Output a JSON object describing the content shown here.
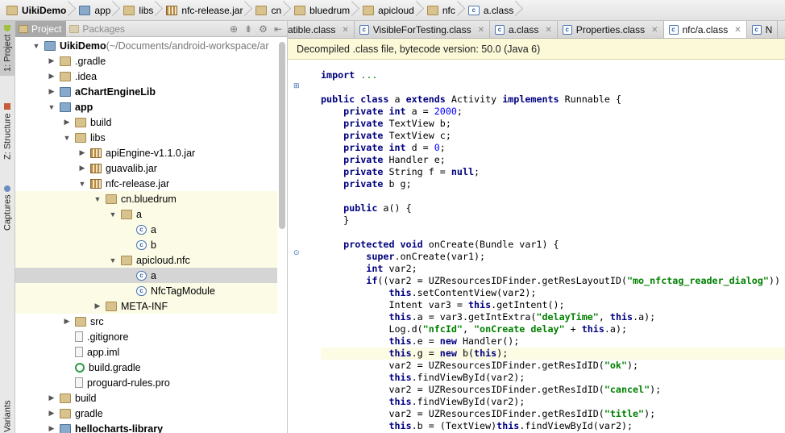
{
  "breadcrumb": [
    {
      "label": "UikiDemo",
      "bold": true,
      "icon": "folder-icon"
    },
    {
      "label": "app",
      "bold": false,
      "icon": "module-folder-icon"
    },
    {
      "label": "libs",
      "bold": false,
      "icon": "folder-icon"
    },
    {
      "label": "nfc-release.jar",
      "bold": false,
      "icon": "jar-icon"
    },
    {
      "label": "cn",
      "bold": false,
      "icon": "package-icon"
    },
    {
      "label": "bluedrum",
      "bold": false,
      "icon": "package-icon"
    },
    {
      "label": "apicloud",
      "bold": false,
      "icon": "package-icon"
    },
    {
      "label": "nfc",
      "bold": false,
      "icon": "package-icon"
    },
    {
      "label": "a.class",
      "bold": false,
      "icon": "class-file-icon"
    }
  ],
  "toolstrip": {
    "project": "1: Project",
    "structure": "Z: Structure",
    "captures": "Captures",
    "variants": "Variants"
  },
  "panel": {
    "tab_project": "Project",
    "tab_packages": "Packages"
  },
  "tree": [
    {
      "depth": 0,
      "arrow": "down",
      "icon": "module",
      "label": "UikiDemo",
      "suffix": " (~/Documents/android-workspace/ar",
      "bold": true
    },
    {
      "depth": 1,
      "arrow": "right",
      "icon": "folder",
      "label": ".gradle"
    },
    {
      "depth": 1,
      "arrow": "right",
      "icon": "folder",
      "label": ".idea"
    },
    {
      "depth": 1,
      "arrow": "right",
      "icon": "module",
      "label": "aChartEngineLib",
      "bold": true
    },
    {
      "depth": 1,
      "arrow": "down",
      "icon": "module",
      "label": "app",
      "bold": true
    },
    {
      "depth": 2,
      "arrow": "right",
      "icon": "folder",
      "label": "build"
    },
    {
      "depth": 2,
      "arrow": "down",
      "icon": "folder",
      "label": "libs"
    },
    {
      "depth": 3,
      "arrow": "right",
      "icon": "jar",
      "label": "apiEngine-v1.1.0.jar"
    },
    {
      "depth": 3,
      "arrow": "right",
      "icon": "jar",
      "label": "guavalib.jar"
    },
    {
      "depth": 3,
      "arrow": "down",
      "icon": "jar",
      "label": "nfc-release.jar"
    },
    {
      "depth": 4,
      "arrow": "down",
      "icon": "package",
      "label": "cn.bluedrum",
      "hl": true
    },
    {
      "depth": 5,
      "arrow": "down",
      "icon": "package",
      "label": "a",
      "hl": true
    },
    {
      "depth": 6,
      "arrow": "",
      "icon": "class",
      "label": "a",
      "hl": true
    },
    {
      "depth": 6,
      "arrow": "",
      "icon": "class",
      "label": "b",
      "hl": true
    },
    {
      "depth": 5,
      "arrow": "down",
      "icon": "package",
      "label": "apicloud.nfc",
      "hl": true
    },
    {
      "depth": 6,
      "arrow": "",
      "icon": "class",
      "label": "a",
      "selected": true
    },
    {
      "depth": 6,
      "arrow": "",
      "icon": "class",
      "label": "NfcTagModule",
      "hl": true
    },
    {
      "depth": 4,
      "arrow": "right",
      "icon": "folder",
      "label": "META-INF",
      "hl": true
    },
    {
      "depth": 2,
      "arrow": "right",
      "icon": "folder",
      "label": "src"
    },
    {
      "depth": 2,
      "arrow": "",
      "icon": "file",
      "label": ".gitignore"
    },
    {
      "depth": 2,
      "arrow": "",
      "icon": "file",
      "label": "app.iml"
    },
    {
      "depth": 2,
      "arrow": "",
      "icon": "gradle",
      "label": "build.gradle"
    },
    {
      "depth": 2,
      "arrow": "",
      "icon": "file",
      "label": "proguard-rules.pro"
    },
    {
      "depth": 1,
      "arrow": "right",
      "icon": "folder",
      "label": "build"
    },
    {
      "depth": 1,
      "arrow": "right",
      "icon": "folder",
      "label": "gradle"
    },
    {
      "depth": 1,
      "arrow": "right",
      "icon": "module",
      "label": "hellocharts-library",
      "bold": true
    }
  ],
  "editor_tabs": [
    {
      "label": "atible.class",
      "icon": "class-file-icon",
      "active": false
    },
    {
      "label": "VisibleForTesting.class",
      "icon": "class-file-icon",
      "active": false
    },
    {
      "label": "a.class",
      "icon": "class-file-icon",
      "active": false
    },
    {
      "label": "Properties.class",
      "icon": "class-file-icon",
      "active": false
    },
    {
      "label": "nfc/a.class",
      "icon": "class-file-icon",
      "active": true
    },
    {
      "label": "N",
      "icon": "class-file-icon",
      "active": false
    }
  ],
  "notice": "Decompiled .class file, bytecode version: 50.0 (Java 6)",
  "code": [
    [
      {
        "t": "import",
        "c": "kw"
      },
      {
        "t": " "
      },
      {
        "t": "...",
        "c": "fold"
      }
    ],
    [],
    [
      {
        "t": "public class",
        "c": "kw"
      },
      {
        "t": " a "
      },
      {
        "t": "extends",
        "c": "kw"
      },
      {
        "t": " Activity "
      },
      {
        "t": "implements",
        "c": "kw"
      },
      {
        "t": " Runnable {"
      }
    ],
    [
      {
        "t": "    "
      },
      {
        "t": "private int",
        "c": "kw"
      },
      {
        "t": " a = "
      },
      {
        "t": "2000",
        "c": "num"
      },
      {
        "t": ";"
      }
    ],
    [
      {
        "t": "    "
      },
      {
        "t": "private",
        "c": "kw"
      },
      {
        "t": " TextView b;"
      }
    ],
    [
      {
        "t": "    "
      },
      {
        "t": "private",
        "c": "kw"
      },
      {
        "t": " TextView c;"
      }
    ],
    [
      {
        "t": "    "
      },
      {
        "t": "private int",
        "c": "kw"
      },
      {
        "t": " d = "
      },
      {
        "t": "0",
        "c": "num"
      },
      {
        "t": ";"
      }
    ],
    [
      {
        "t": "    "
      },
      {
        "t": "private",
        "c": "kw"
      },
      {
        "t": " Handler e;"
      }
    ],
    [
      {
        "t": "    "
      },
      {
        "t": "private",
        "c": "kw"
      },
      {
        "t": " String f = "
      },
      {
        "t": "null",
        "c": "kw"
      },
      {
        "t": ";"
      }
    ],
    [
      {
        "t": "    "
      },
      {
        "t": "private",
        "c": "kw"
      },
      {
        "t": " b g;"
      }
    ],
    [],
    [
      {
        "t": "    "
      },
      {
        "t": "public",
        "c": "kw"
      },
      {
        "t": " a() {"
      }
    ],
    [
      {
        "t": "    }"
      }
    ],
    [],
    [
      {
        "t": "    "
      },
      {
        "t": "protected void",
        "c": "kw"
      },
      {
        "t": " onCreate(Bundle var1) {"
      }
    ],
    [
      {
        "t": "        "
      },
      {
        "t": "super",
        "c": "kw"
      },
      {
        "t": ".onCreate(var1);"
      }
    ],
    [
      {
        "t": "        "
      },
      {
        "t": "int",
        "c": "kw"
      },
      {
        "t": " var2;"
      }
    ],
    [
      {
        "t": "        "
      },
      {
        "t": "if",
        "c": "kw"
      },
      {
        "t": "((var2 = UZResourcesIDFinder.getResLayoutID("
      },
      {
        "t": "\"mo_nfctag_reader_dialog\"",
        "c": "str"
      },
      {
        "t": ")) >"
      }
    ],
    [
      {
        "t": "            "
      },
      {
        "t": "this",
        "c": "kw"
      },
      {
        "t": ".setContentView(var2);"
      }
    ],
    [
      {
        "t": "            Intent var3 = "
      },
      {
        "t": "this",
        "c": "kw"
      },
      {
        "t": ".getIntent();"
      }
    ],
    [
      {
        "t": "            "
      },
      {
        "t": "this",
        "c": "kw"
      },
      {
        "t": ".a = var3.getIntExtra("
      },
      {
        "t": "\"delayTime\"",
        "c": "str"
      },
      {
        "t": ", "
      },
      {
        "t": "this",
        "c": "kw"
      },
      {
        "t": ".a);"
      }
    ],
    [
      {
        "t": "            Log.d("
      },
      {
        "t": "\"nfcId\"",
        "c": "str"
      },
      {
        "t": ", "
      },
      {
        "t": "\"onCreate delay\"",
        "c": "str"
      },
      {
        "t": " + "
      },
      {
        "t": "this",
        "c": "kw"
      },
      {
        "t": ".a);"
      }
    ],
    [
      {
        "t": "            "
      },
      {
        "t": "this",
        "c": "kw"
      },
      {
        "t": ".e = "
      },
      {
        "t": "new",
        "c": "kw"
      },
      {
        "t": " Handler();"
      }
    ],
    [
      {
        "t": "            "
      },
      {
        "t": "this",
        "c": "kw"
      },
      {
        "t": ".g = "
      },
      {
        "t": "new",
        "c": "kw"
      },
      {
        "t": " b("
      },
      {
        "t": "this",
        "c": "kw"
      },
      {
        "t": ");"
      }
    ],
    [
      {
        "t": "            var2 = UZResourcesIDFinder.getResIdID("
      },
      {
        "t": "\"ok\"",
        "c": "str"
      },
      {
        "t": ");"
      }
    ],
    [
      {
        "t": "            "
      },
      {
        "t": "this",
        "c": "kw"
      },
      {
        "t": ".findViewById(var2);"
      }
    ],
    [
      {
        "t": "            var2 = UZResourcesIDFinder.getResIdID("
      },
      {
        "t": "\"cancel\"",
        "c": "str"
      },
      {
        "t": ");"
      }
    ],
    [
      {
        "t": "            "
      },
      {
        "t": "this",
        "c": "kw"
      },
      {
        "t": ".findViewById(var2);"
      }
    ],
    [
      {
        "t": "            var2 = UZResourcesIDFinder.getResIdID("
      },
      {
        "t": "\"title\"",
        "c": "str"
      },
      {
        "t": ");"
      }
    ],
    [
      {
        "t": "            "
      },
      {
        "t": "this",
        "c": "kw"
      },
      {
        "t": ".b = (TextView)"
      },
      {
        "t": "this",
        "c": "kw"
      },
      {
        "t": ".findViewById(var2);"
      }
    ]
  ],
  "current_line": 23,
  "colors": {
    "keyword": "#000080",
    "string": "#008000",
    "number": "#0000ff",
    "notice_bg": "#fbf9d8",
    "selection": "#d5d5d5"
  }
}
